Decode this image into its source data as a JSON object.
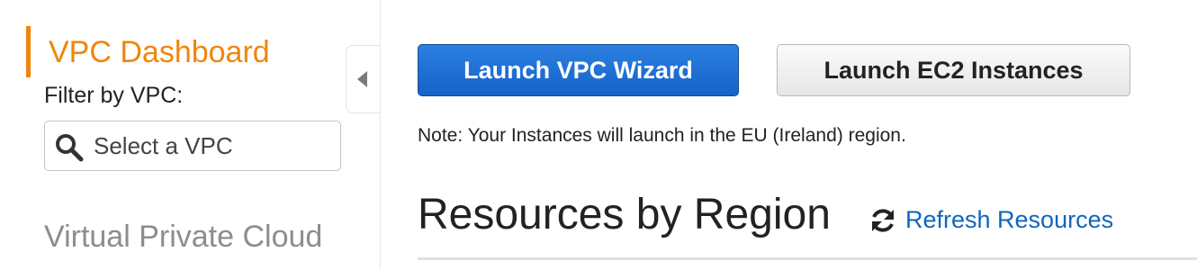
{
  "sidebar": {
    "title": "VPC Dashboard",
    "filter_label": "Filter by VPC:",
    "vpc_select": {
      "placeholder": "Select a VPC",
      "icon": "search-icon"
    },
    "section_heading": "Virtual Private Cloud",
    "collapse_icon": "chevron-left-icon",
    "accent_color": "#f0860b"
  },
  "main": {
    "launch_vpc_wizard_label": "Launch VPC Wizard",
    "launch_ec2_instances_label": "Launch EC2 Instances",
    "region_note": "Note: Your Instances will launch in the EU (Ireland) region.",
    "resources_title": "Resources by Region",
    "refresh": {
      "label": "Refresh Resources",
      "icon": "refresh-icon"
    },
    "primary_color": "#1563c9",
    "link_color": "#1166bb"
  }
}
